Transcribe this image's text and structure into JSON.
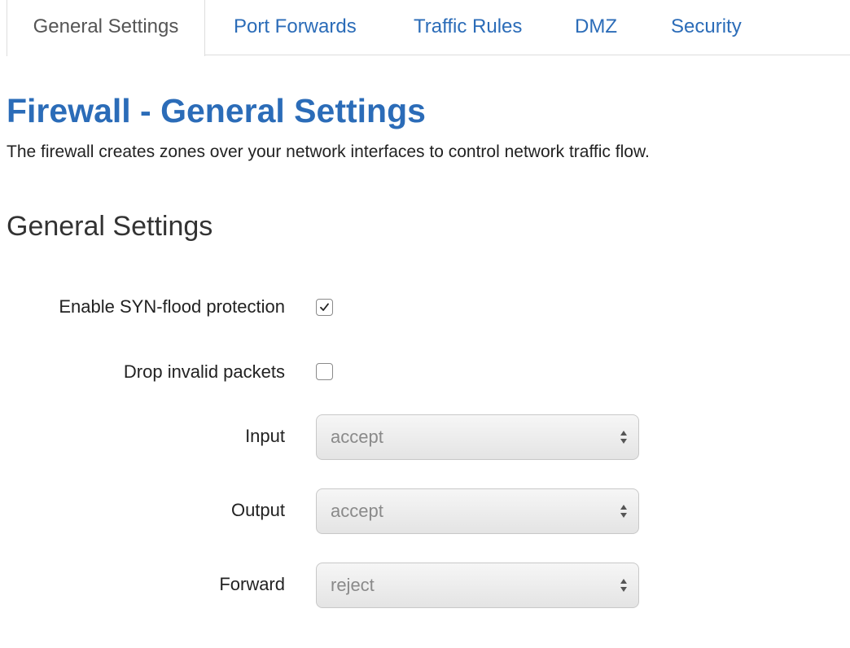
{
  "tabs": [
    {
      "label": "General Settings",
      "active": true
    },
    {
      "label": "Port Forwards",
      "active": false
    },
    {
      "label": "Traffic Rules",
      "active": false
    },
    {
      "label": "DMZ",
      "active": false
    },
    {
      "label": "Security",
      "active": false
    }
  ],
  "page": {
    "title": "Firewall - General Settings",
    "description": "The firewall creates zones over your network interfaces to control network traffic flow."
  },
  "section": {
    "title": "General Settings"
  },
  "fields": {
    "syn_flood": {
      "label": "Enable SYN-flood protection",
      "checked": true
    },
    "drop_invalid": {
      "label": "Drop invalid packets",
      "checked": false
    },
    "input": {
      "label": "Input",
      "value": "accept"
    },
    "output": {
      "label": "Output",
      "value": "accept"
    },
    "forward": {
      "label": "Forward",
      "value": "reject"
    }
  },
  "icons": {
    "checkmark": "checkmark-icon",
    "select_arrows": "up-down-arrows-icon"
  },
  "colors": {
    "link_blue": "#2b6cb8",
    "active_tab_text": "#555555",
    "border": "#dddddd"
  }
}
